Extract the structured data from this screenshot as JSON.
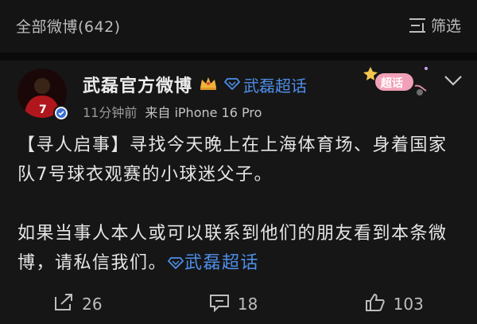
{
  "header": {
    "title": "全部微博(642)",
    "filter_label": "筛选"
  },
  "post": {
    "author": "武磊官方微博",
    "topic_tag": "武磊超话",
    "time": "11分钟前",
    "source": "来自 iPhone 16 Pro",
    "super_badge": "超话",
    "paragraph1": "【寻人启事】寻找今天晚上在上海体育场、身着国家队7号球衣观赛的小球迷父子。",
    "paragraph2": "如果当事人本人或可以联系到他们的朋友看到本条微博，请私信我们。",
    "inline_topic": "武磊超话",
    "jersey_number": "7"
  },
  "actions": {
    "repost_count": "26",
    "comment_count": "18",
    "like_count": "103"
  },
  "colors": {
    "link": "#4d8ee8",
    "background": "#161616"
  },
  "icons": [
    "filter-icon",
    "crown-icon",
    "diamond-icon",
    "super-topic-badge-icon",
    "chevron-down-icon",
    "verified-icon",
    "repost-icon",
    "comment-icon",
    "like-icon"
  ]
}
